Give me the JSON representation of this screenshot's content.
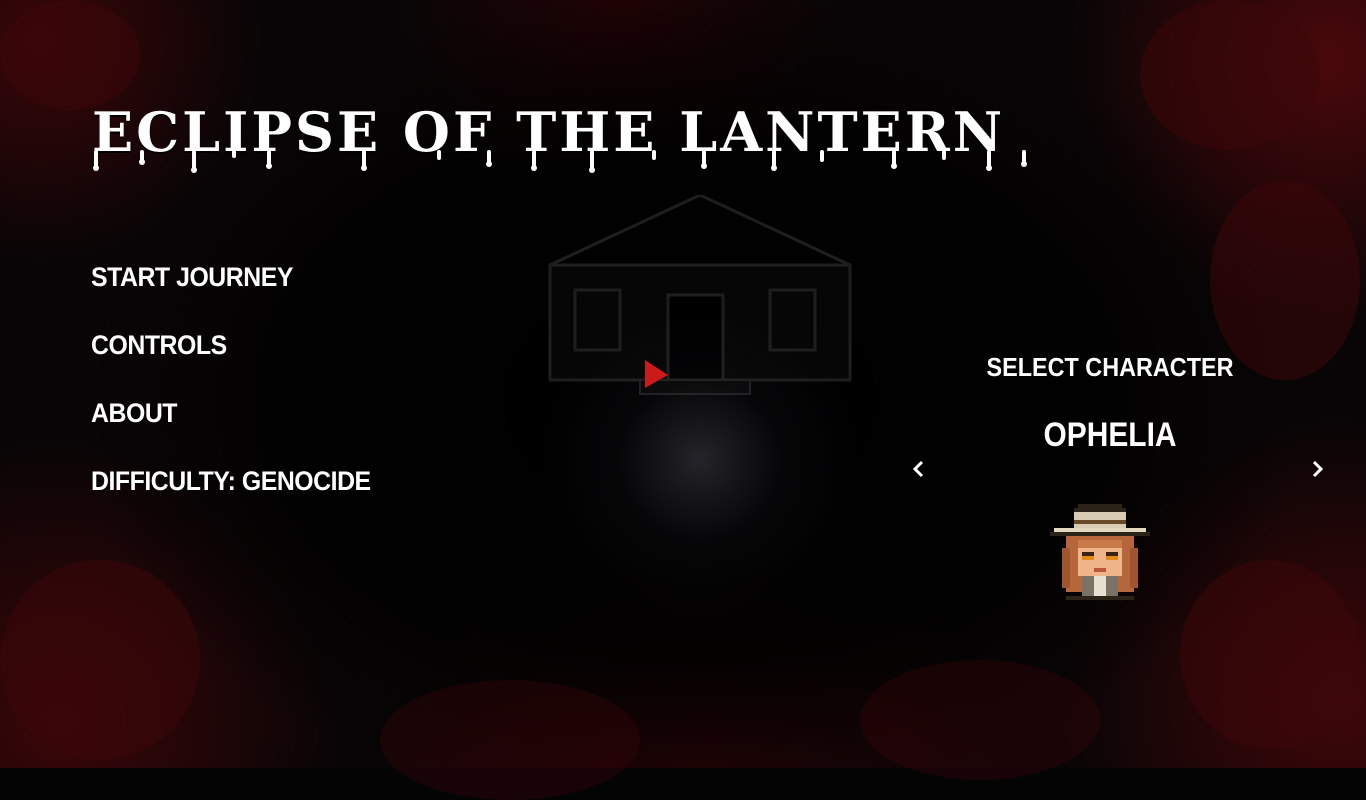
{
  "game": {
    "title": "ECLIPSE OF THE LANTERN"
  },
  "menu": {
    "items": [
      {
        "label": "START JOURNEY"
      },
      {
        "label": "CONTROLS"
      },
      {
        "label": "ABOUT"
      },
      {
        "label": "DIFFICULTY: GENOCIDE"
      }
    ]
  },
  "character_select": {
    "label": "SELECT CHARACTER",
    "selected_name": "OPHELIA",
    "prev_icon": "chevron-left-icon",
    "next_icon": "chevron-right-icon"
  },
  "colors": {
    "accent_red": "#cc1a1a",
    "blood": "#3d0709",
    "text": "#ffffff"
  }
}
